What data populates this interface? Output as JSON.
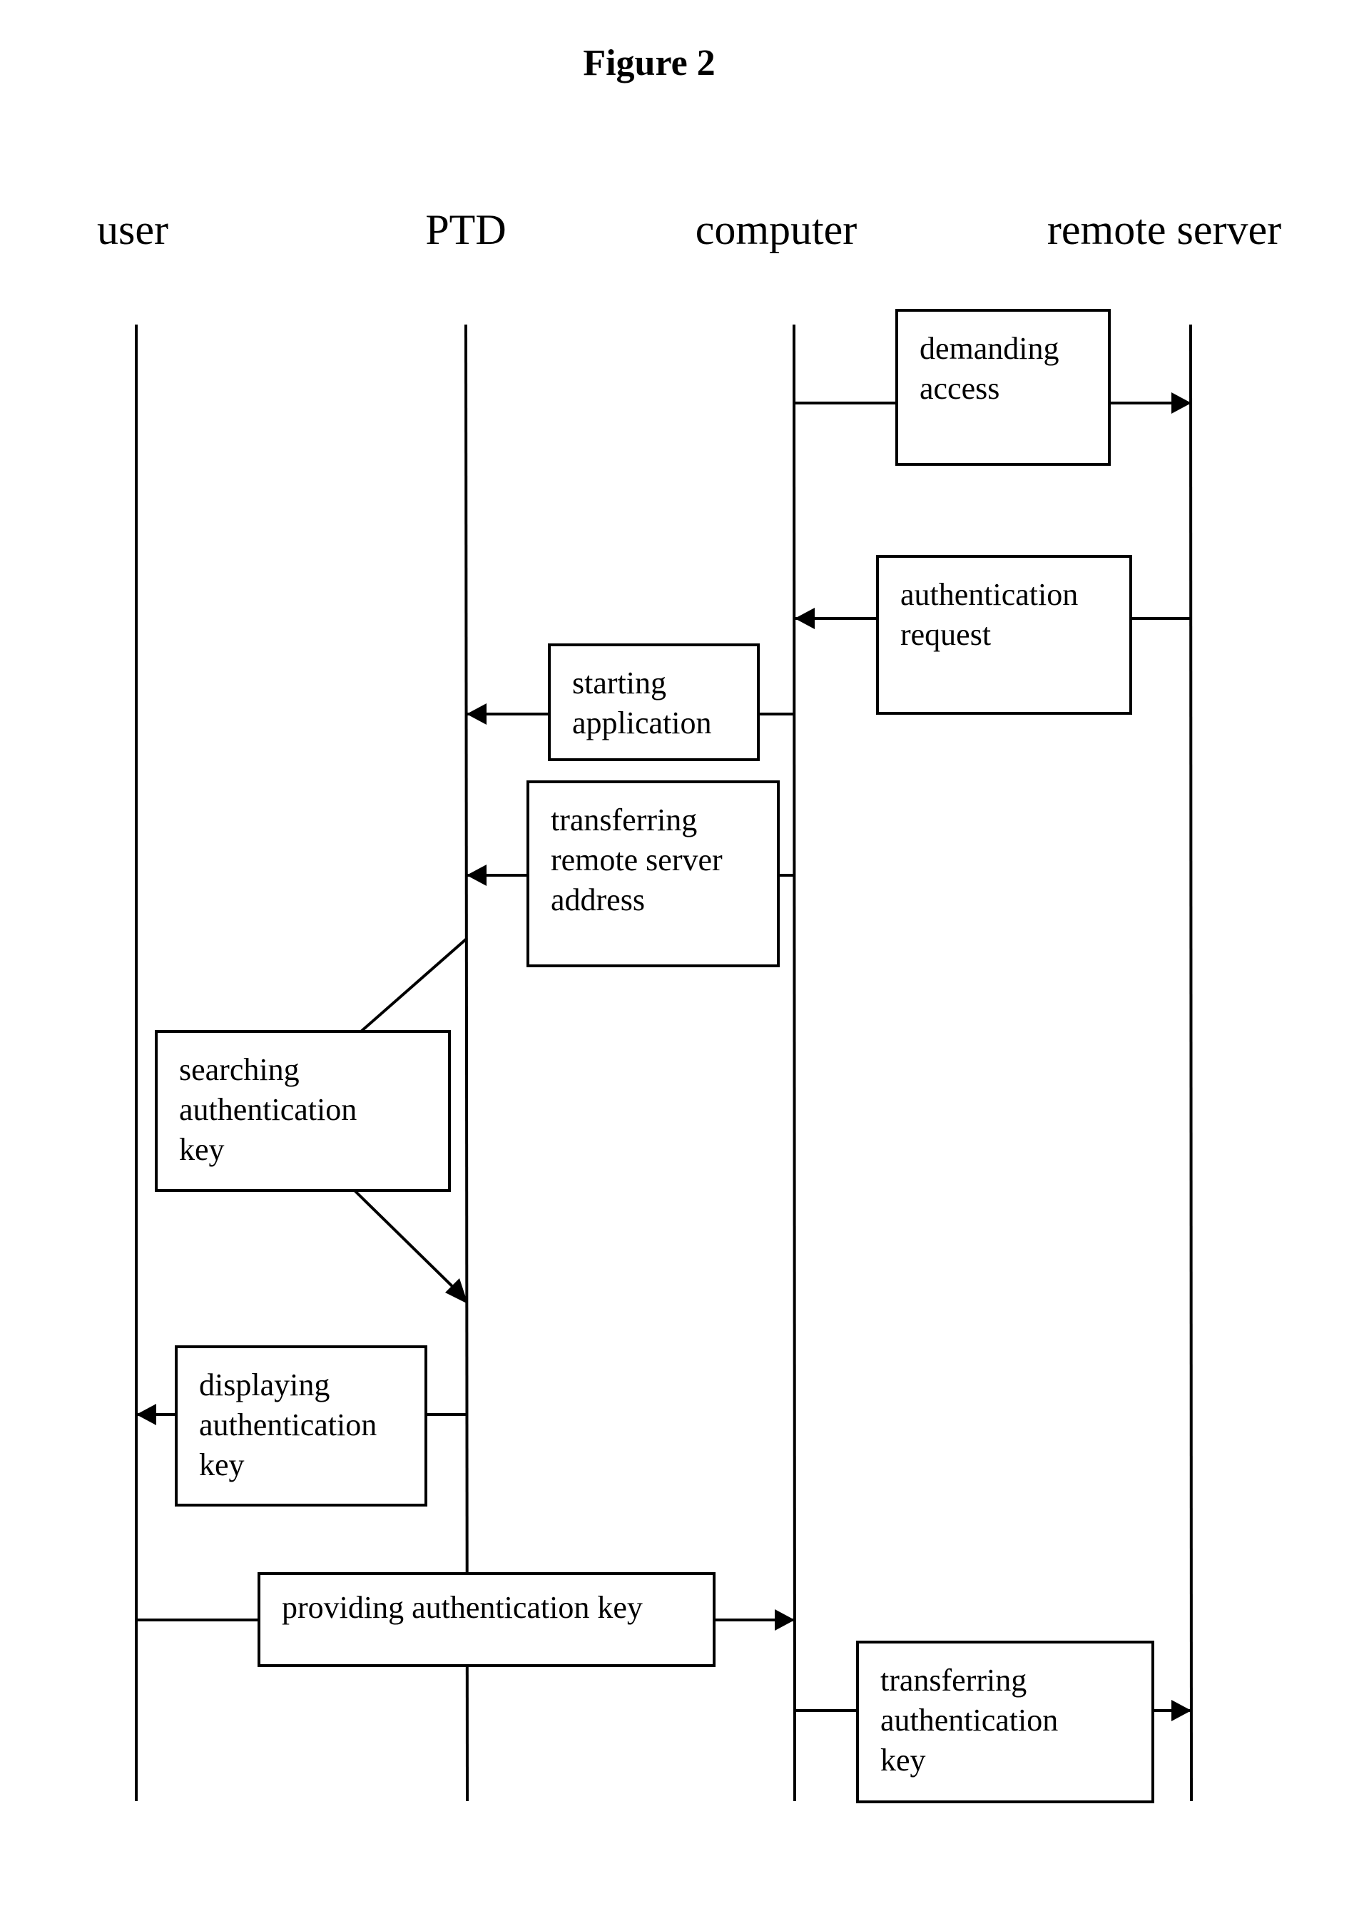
{
  "figure": {
    "title": "Figure 2"
  },
  "actors": [
    {
      "id": "user",
      "label": "user"
    },
    {
      "id": "ptd",
      "label": "PTD"
    },
    {
      "id": "computer",
      "label": "computer"
    },
    {
      "id": "server",
      "label": "remote server"
    }
  ],
  "messages": [
    {
      "from": "computer",
      "to": "server",
      "lines": [
        "demanding",
        "access"
      ]
    },
    {
      "from": "server",
      "to": "computer",
      "lines": [
        "authentication",
        "request"
      ]
    },
    {
      "from": "computer",
      "to": "ptd",
      "lines": [
        "starting",
        "application"
      ]
    },
    {
      "from": "computer",
      "to": "ptd",
      "lines": [
        "transferring",
        "remote server",
        "address"
      ]
    },
    {
      "from": "ptd",
      "to": "ptd",
      "lines": [
        "searching",
        "authentication",
        "key"
      ]
    },
    {
      "from": "ptd",
      "to": "user",
      "lines": [
        "displaying",
        "authentication",
        "key"
      ]
    },
    {
      "from": "user",
      "to": "computer",
      "lines": [
        "providing authentication key"
      ]
    },
    {
      "from": "computer",
      "to": "server",
      "lines": [
        "transferring",
        "authentication",
        "key"
      ]
    }
  ]
}
